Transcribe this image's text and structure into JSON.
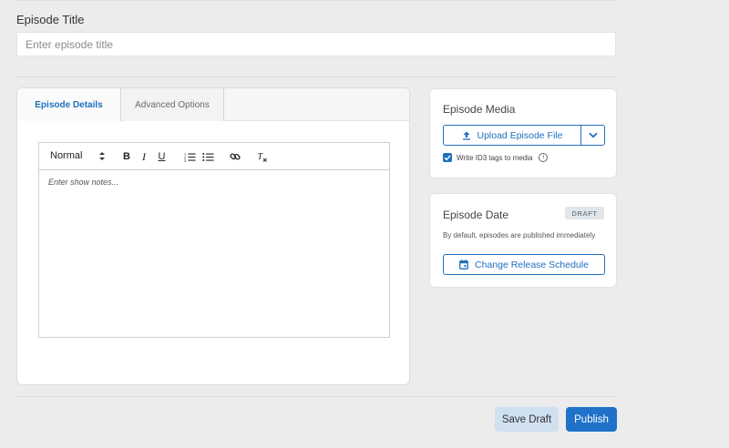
{
  "episode_title": {
    "label": "Episode Title",
    "placeholder": "Enter episode title",
    "value": ""
  },
  "tabs": [
    {
      "label": "Episode Details",
      "active": true
    },
    {
      "label": "Advanced Options",
      "active": false
    }
  ],
  "editor": {
    "format_select": "Normal",
    "toolbar_icons": [
      "bold-icon",
      "italic-icon",
      "underline-icon",
      "ordered-list-icon",
      "bullet-list-icon",
      "link-icon",
      "clear-format-icon"
    ],
    "bold_label": "B",
    "italic_label": "I",
    "underline_label": "U",
    "placeholder": "Enter show notes..."
  },
  "media": {
    "heading": "Episode Media",
    "upload_label": "Upload Episode File",
    "id3_label": "Write ID3 tags to media",
    "id3_checked": true,
    "info_glyph": "i"
  },
  "release": {
    "heading": "Episode Date",
    "badge": "DRAFT",
    "note": "By default, episodes are published immediately",
    "button_label": "Change Release Schedule"
  },
  "actions": {
    "save_draft": "Save Draft",
    "publish": "Publish"
  },
  "colors": {
    "accent": "#1f72c8",
    "save_draft_bg": "#cfe0f1",
    "badge_bg": "#e1e6eb",
    "page_bg": "#ececec"
  }
}
